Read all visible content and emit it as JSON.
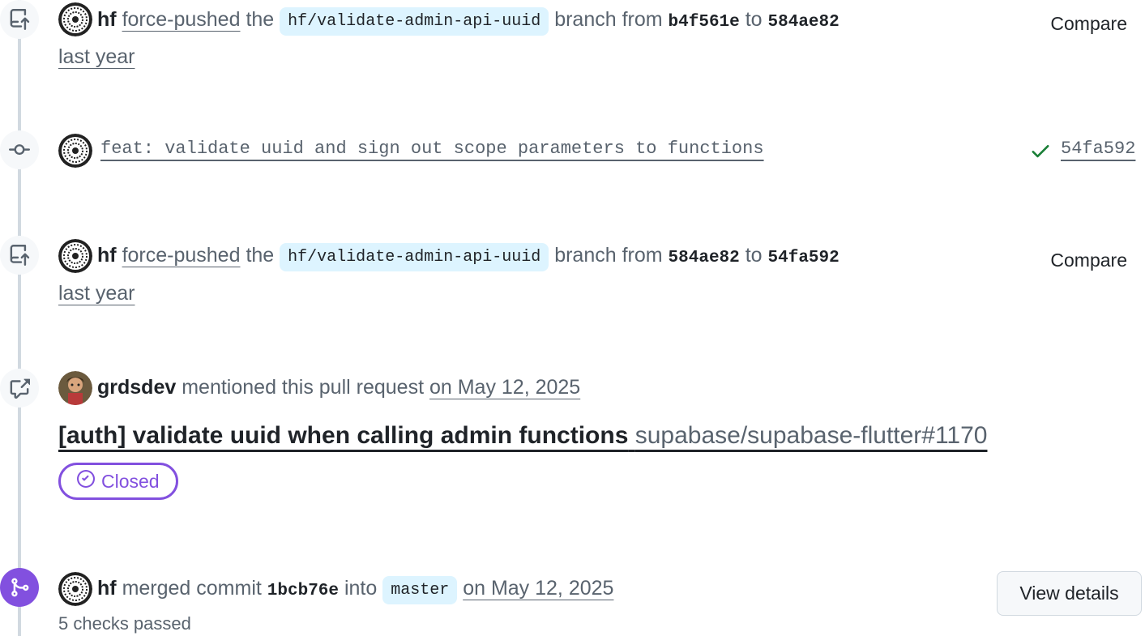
{
  "events": [
    {
      "actor": "hf",
      "action": "force-pushed",
      "the": "the",
      "branch": "hf/validate-admin-api-uuid",
      "branch_from": "branch from",
      "from_sha": "b4f561e",
      "to": "to",
      "to_sha": "584ae82",
      "compare": "Compare",
      "time": "last year"
    },
    {
      "commit_message": "feat: validate uuid and sign out scope parameters to functions",
      "commit_sha": "54fa592",
      "status": "success"
    },
    {
      "actor": "hf",
      "action": "force-pushed",
      "the": "the",
      "branch": "hf/validate-admin-api-uuid",
      "branch_from": "branch from",
      "from_sha": "584ae82",
      "to": "to",
      "to_sha": "54fa592",
      "compare": "Compare",
      "time": "last year"
    },
    {
      "actor": "grdsdev",
      "action": "mentioned this pull request",
      "time": "on May 12, 2025",
      "reference_title": "[auth] validate uuid when calling admin functions",
      "reference_repo": "supabase/supabase-flutter#1170",
      "state": "Closed"
    },
    {
      "actor": "hf",
      "action": "merged commit",
      "commit_sha": "1bcb76e",
      "into": "into",
      "base_branch": "master",
      "time": "on May 12, 2025",
      "details_button": "View details",
      "checks": "5 checks passed"
    }
  ],
  "colors": {
    "merged": "#8250df",
    "success": "#1a7f37",
    "branch_bg": "#ddf4ff",
    "muted": "#59636e"
  },
  "icons": [
    "repo-push-icon",
    "git-commit-icon",
    "cross-reference-icon",
    "git-merge-icon",
    "check-icon",
    "check-circle-icon"
  ]
}
